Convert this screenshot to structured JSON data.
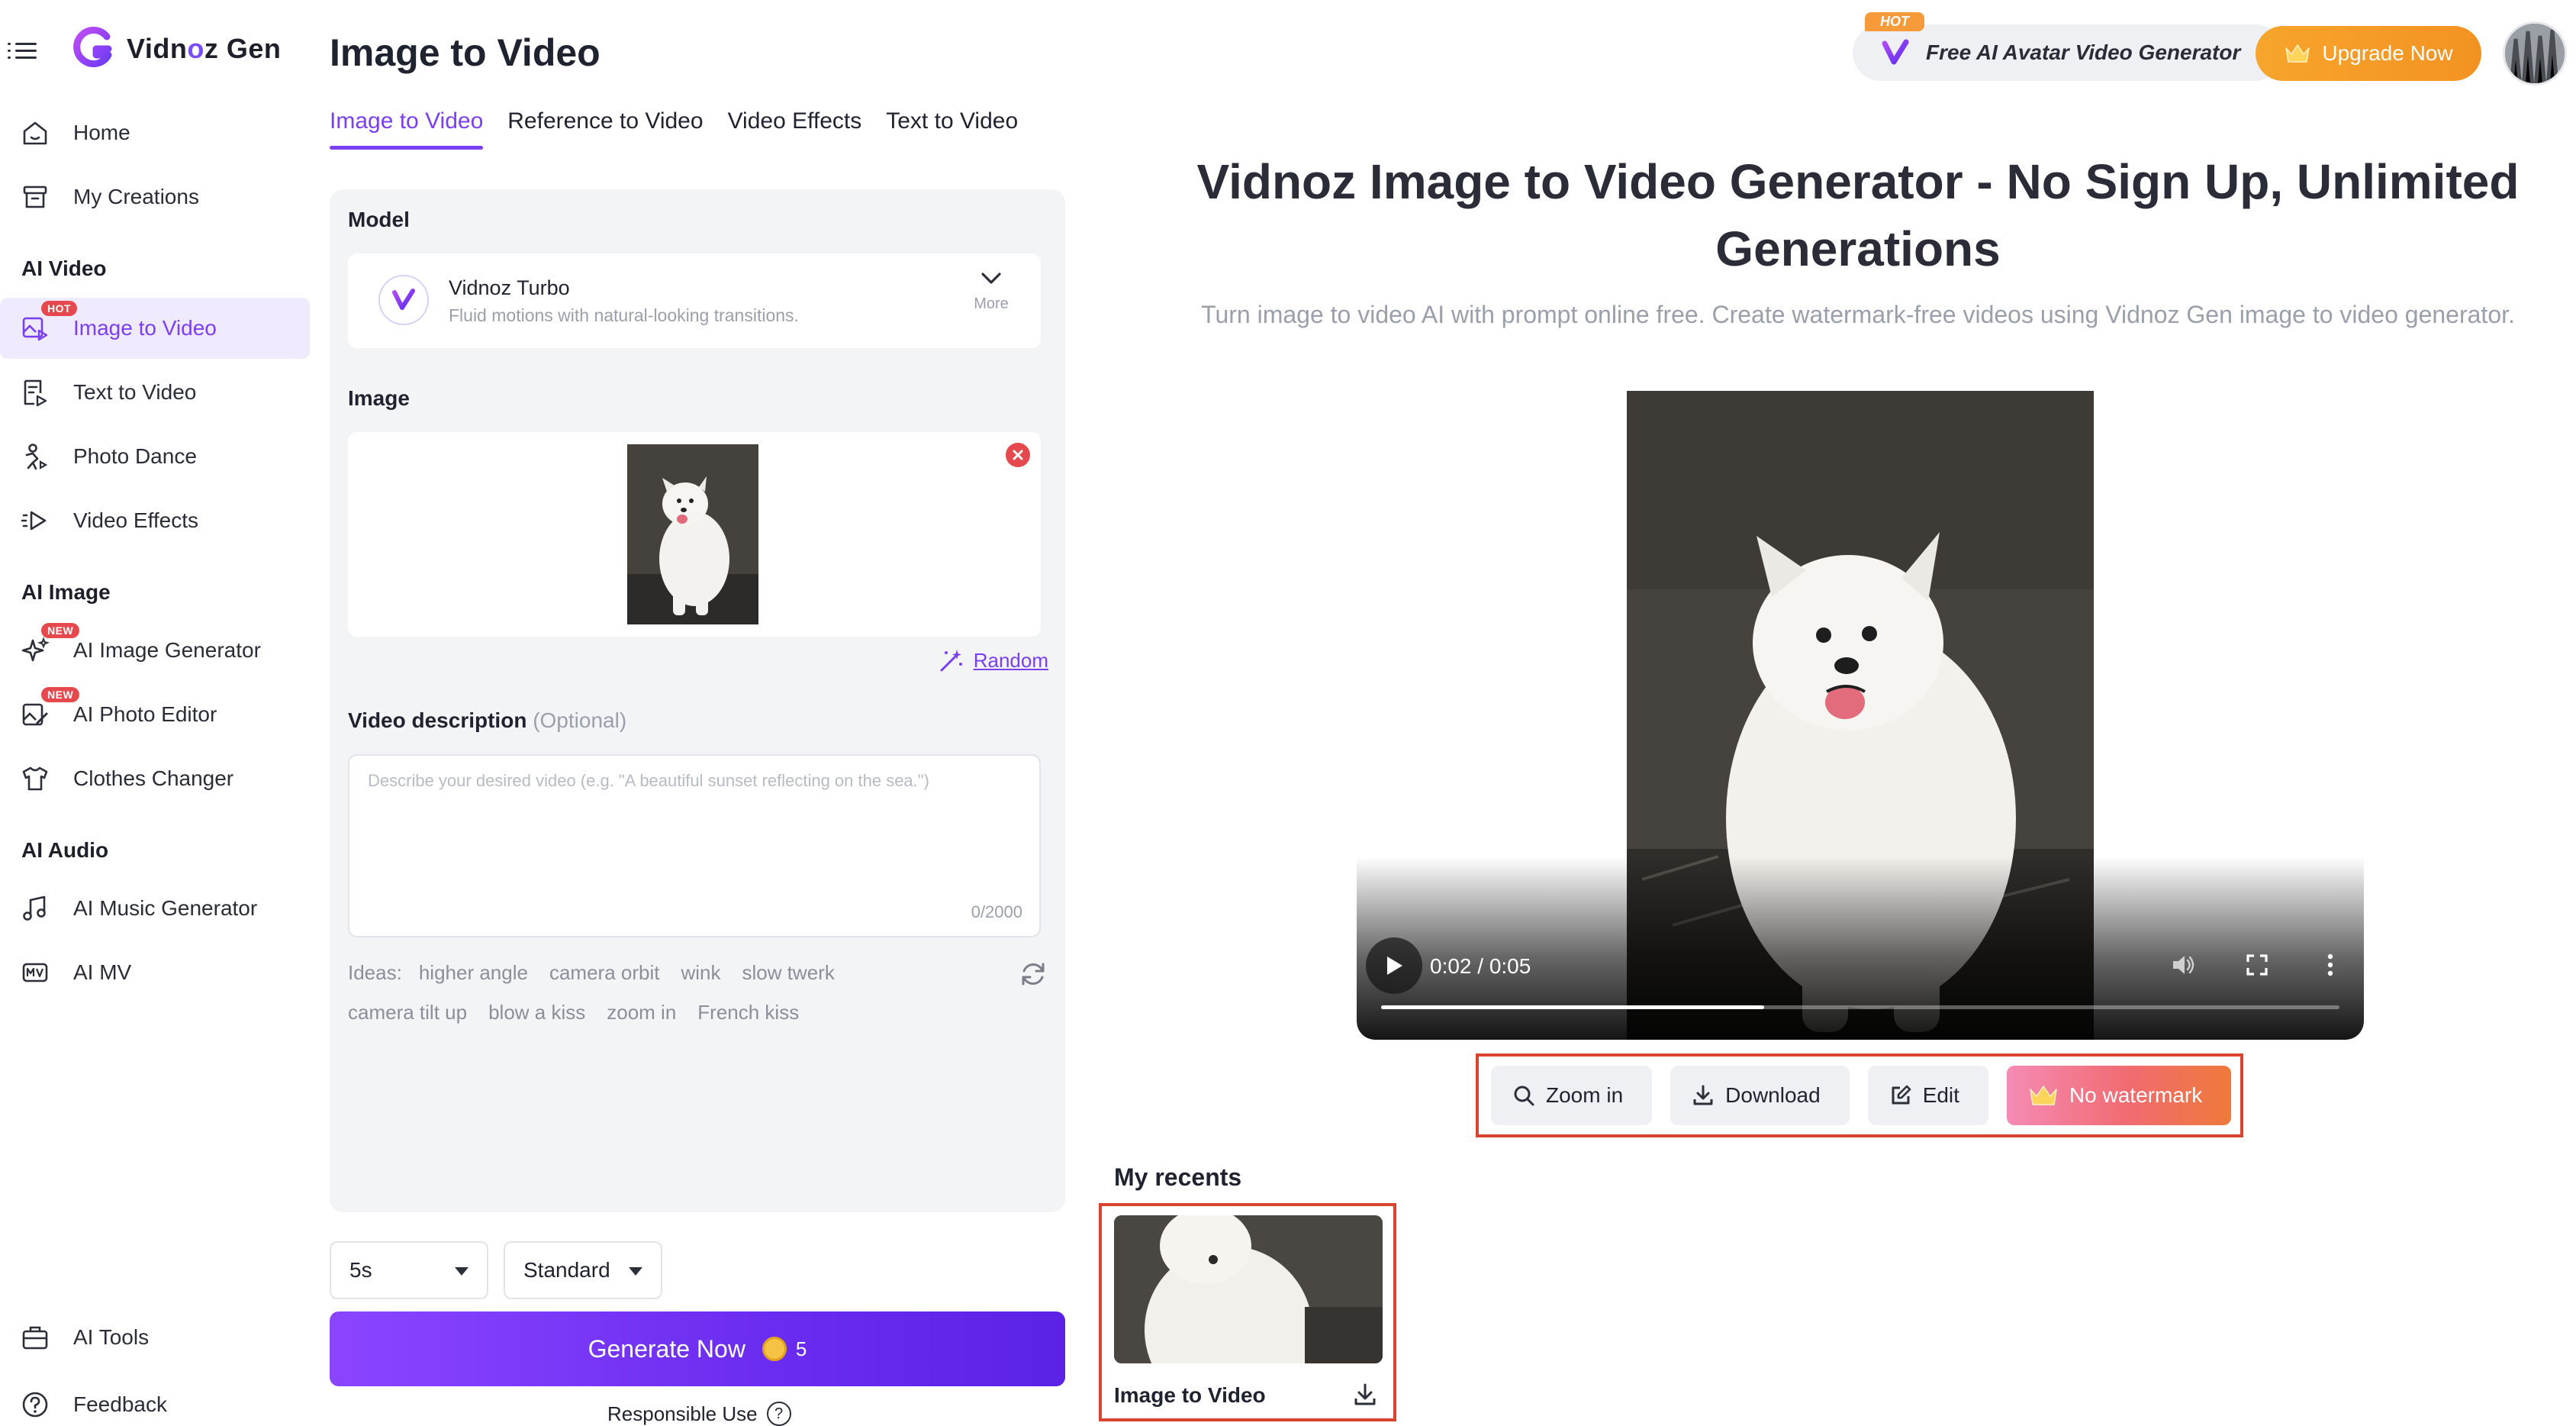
{
  "sidebar": {
    "logo_text_a": "Vidn",
    "logo_text_o": "o",
    "logo_text_b": "z Gen",
    "items": [
      {
        "label": "Home"
      },
      {
        "label": "My Creations"
      },
      {
        "label": "Image to Video",
        "badge": "HOT"
      },
      {
        "label": "Text to Video"
      },
      {
        "label": "Photo Dance"
      },
      {
        "label": "Video Effects"
      },
      {
        "label": "AI Image Generator",
        "badge": "NEW"
      },
      {
        "label": "AI Photo Editor",
        "badge": "NEW"
      },
      {
        "label": "Clothes Changer"
      },
      {
        "label": "AI Music Generator"
      },
      {
        "label": "AI MV"
      },
      {
        "label": "AI Tools"
      },
      {
        "label": "Feedback"
      }
    ],
    "sections": {
      "ai_video": "AI Video",
      "ai_image": "AI Image",
      "ai_audio": "AI Audio"
    }
  },
  "header": {
    "page_title": "Image to Video",
    "promo_badge": "HOT",
    "promo_text": "Free AI Avatar Video Generator",
    "upgrade_label": "Upgrade Now"
  },
  "tabs": [
    {
      "label": "Image to Video",
      "active": true
    },
    {
      "label": "Reference to Video"
    },
    {
      "label": "Video Effects"
    },
    {
      "label": "Text to Video"
    }
  ],
  "form": {
    "model_label": "Model",
    "model_name": "Vidnoz Turbo",
    "model_desc": "Fluid motions with natural-looking transitions.",
    "model_more": "More",
    "image_label": "Image",
    "random_label": "Random",
    "desc_label": "Video description",
    "desc_optional": "(Optional)",
    "desc_placeholder": "Describe your desired video (e.g. \"A beautiful sunset reflecting on the sea.\")",
    "desc_counter": "0/2000",
    "ideas_label": "Ideas:",
    "ideas": [
      "higher angle",
      "camera orbit",
      "wink",
      "slow twerk",
      "camera tilt up",
      "blow a kiss",
      "zoom in",
      "French kiss"
    ],
    "duration": "5s",
    "quality": "Standard",
    "generate_label": "Generate Now",
    "generate_cost": "5",
    "responsible_label": "Responsible Use"
  },
  "hero": {
    "title": "Vidnoz Image to Video Generator - No Sign Up, Unlimited Generations",
    "subtitle": "Turn image to video AI with prompt online free. Create watermark-free videos using Vidnoz Gen image to video generator."
  },
  "player": {
    "time": "0:02 / 0:05",
    "progress": 0.4
  },
  "actions": {
    "zoom_label": "Zoom in",
    "download_label": "Download",
    "edit_label": "Edit",
    "nowatermark_label": "No watermark"
  },
  "recents": {
    "title": "My recents",
    "item_label": "Image to Video"
  },
  "colors": {
    "accent": "#7b3ff2",
    "upgrade": "#f39222",
    "highlight_border": "#d9432f"
  }
}
